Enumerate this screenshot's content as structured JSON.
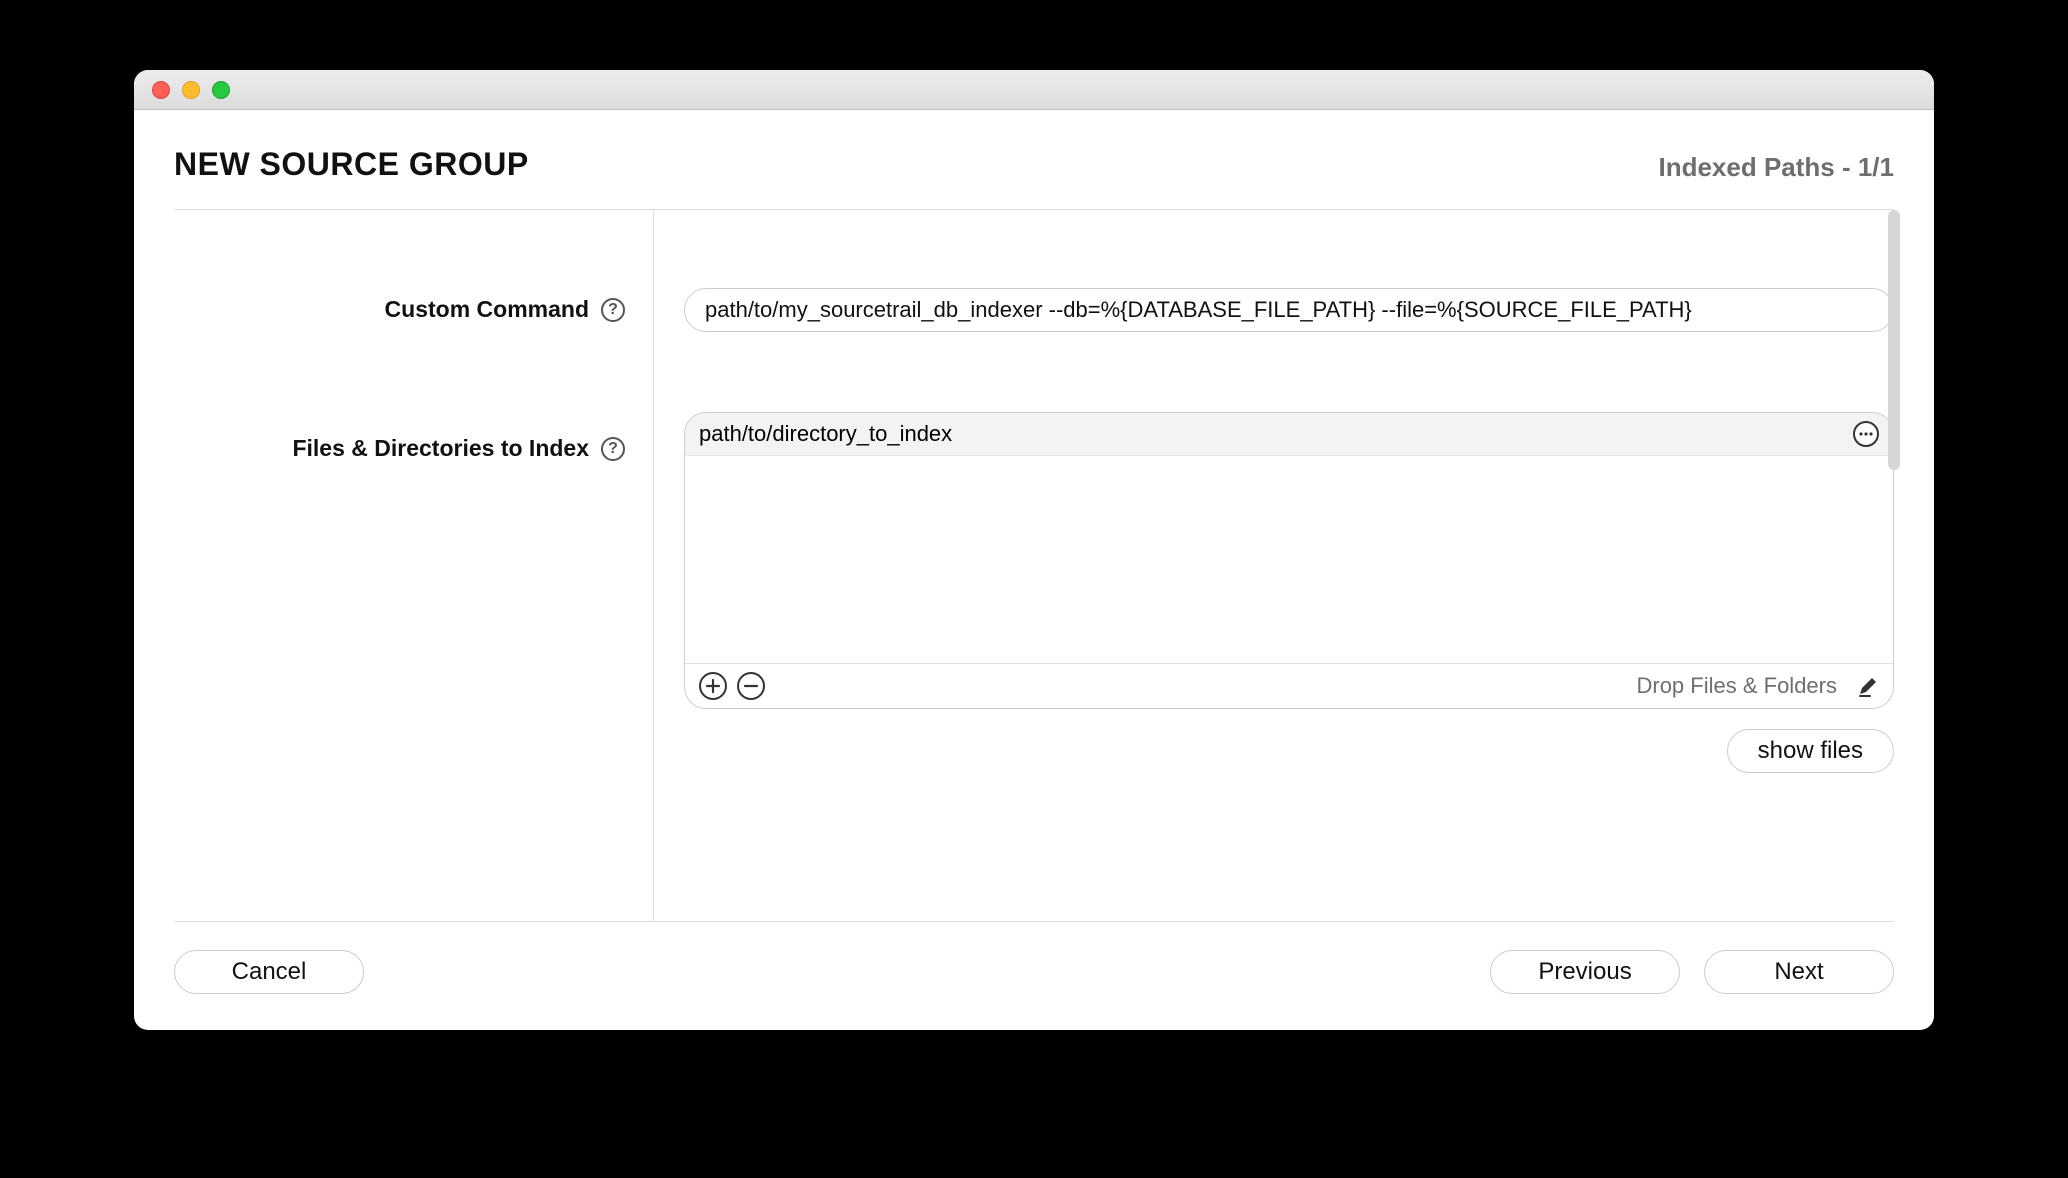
{
  "header": {
    "title": "NEW SOURCE GROUP",
    "status": "Indexed Paths - 1/1"
  },
  "labels": {
    "custom_command": "Custom Command",
    "files_to_index": "Files & Directories to Index"
  },
  "custom_command": {
    "value": "path/to/my_sourcetrail_db_indexer --db=%{DATABASE_FILE_PATH} --file=%{SOURCE_FILE_PATH}"
  },
  "files": {
    "items": [
      {
        "path": "path/to/directory_to_index"
      }
    ],
    "drop_hint": "Drop Files & Folders"
  },
  "buttons": {
    "show_files": "show files",
    "cancel": "Cancel",
    "previous": "Previous",
    "next": "Next"
  }
}
